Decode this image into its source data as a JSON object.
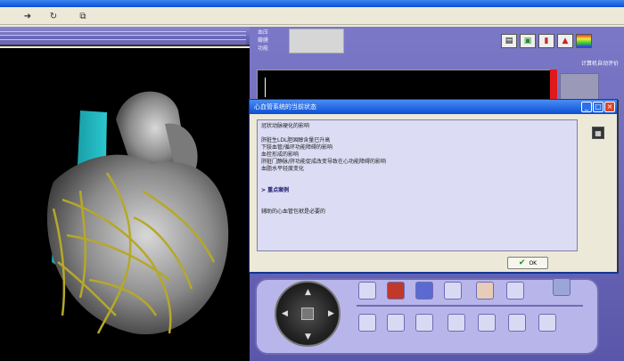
{
  "window": {
    "title": ""
  },
  "toolbar": {
    "buttons": [
      {
        "name": "forward",
        "glyph": "➜"
      },
      {
        "name": "refresh",
        "glyph": "↻"
      },
      {
        "name": "copy",
        "glyph": "⧉"
      }
    ]
  },
  "right_panel": {
    "labels": [
      "血压",
      "瓣膜",
      "功能"
    ],
    "auto_eval_label": "计算机自动评价",
    "icons": [
      "document-icon",
      "panel-icon",
      "chart-icon",
      "warning-icon",
      "spectrum-icon"
    ]
  },
  "dialog": {
    "title": "心血管系统的当前状态",
    "heading": "冠状动脉硬化的影响",
    "lines": [
      "肝脏生LDL胆固醇含量已升高",
      "下肢血管/循环功能障碍的影响",
      "血栓形成的影响",
      "肝脏门静脉/肝功能促成改变导致在心功能障碍的影响",
      "血脂水平轻度变化"
    ],
    "section_heading": "> 重点案例",
    "footer_text": "辅助的心血管包袱是必要的",
    "ok_label": "OK",
    "colors": {
      "title_bar": "#0b4ed4",
      "content_bg": "#dcdcf4"
    }
  },
  "colors": {
    "panel_purple": "#6a67b6",
    "monitor_red": "#e01a1a",
    "viewport_bg": "#000000"
  }
}
